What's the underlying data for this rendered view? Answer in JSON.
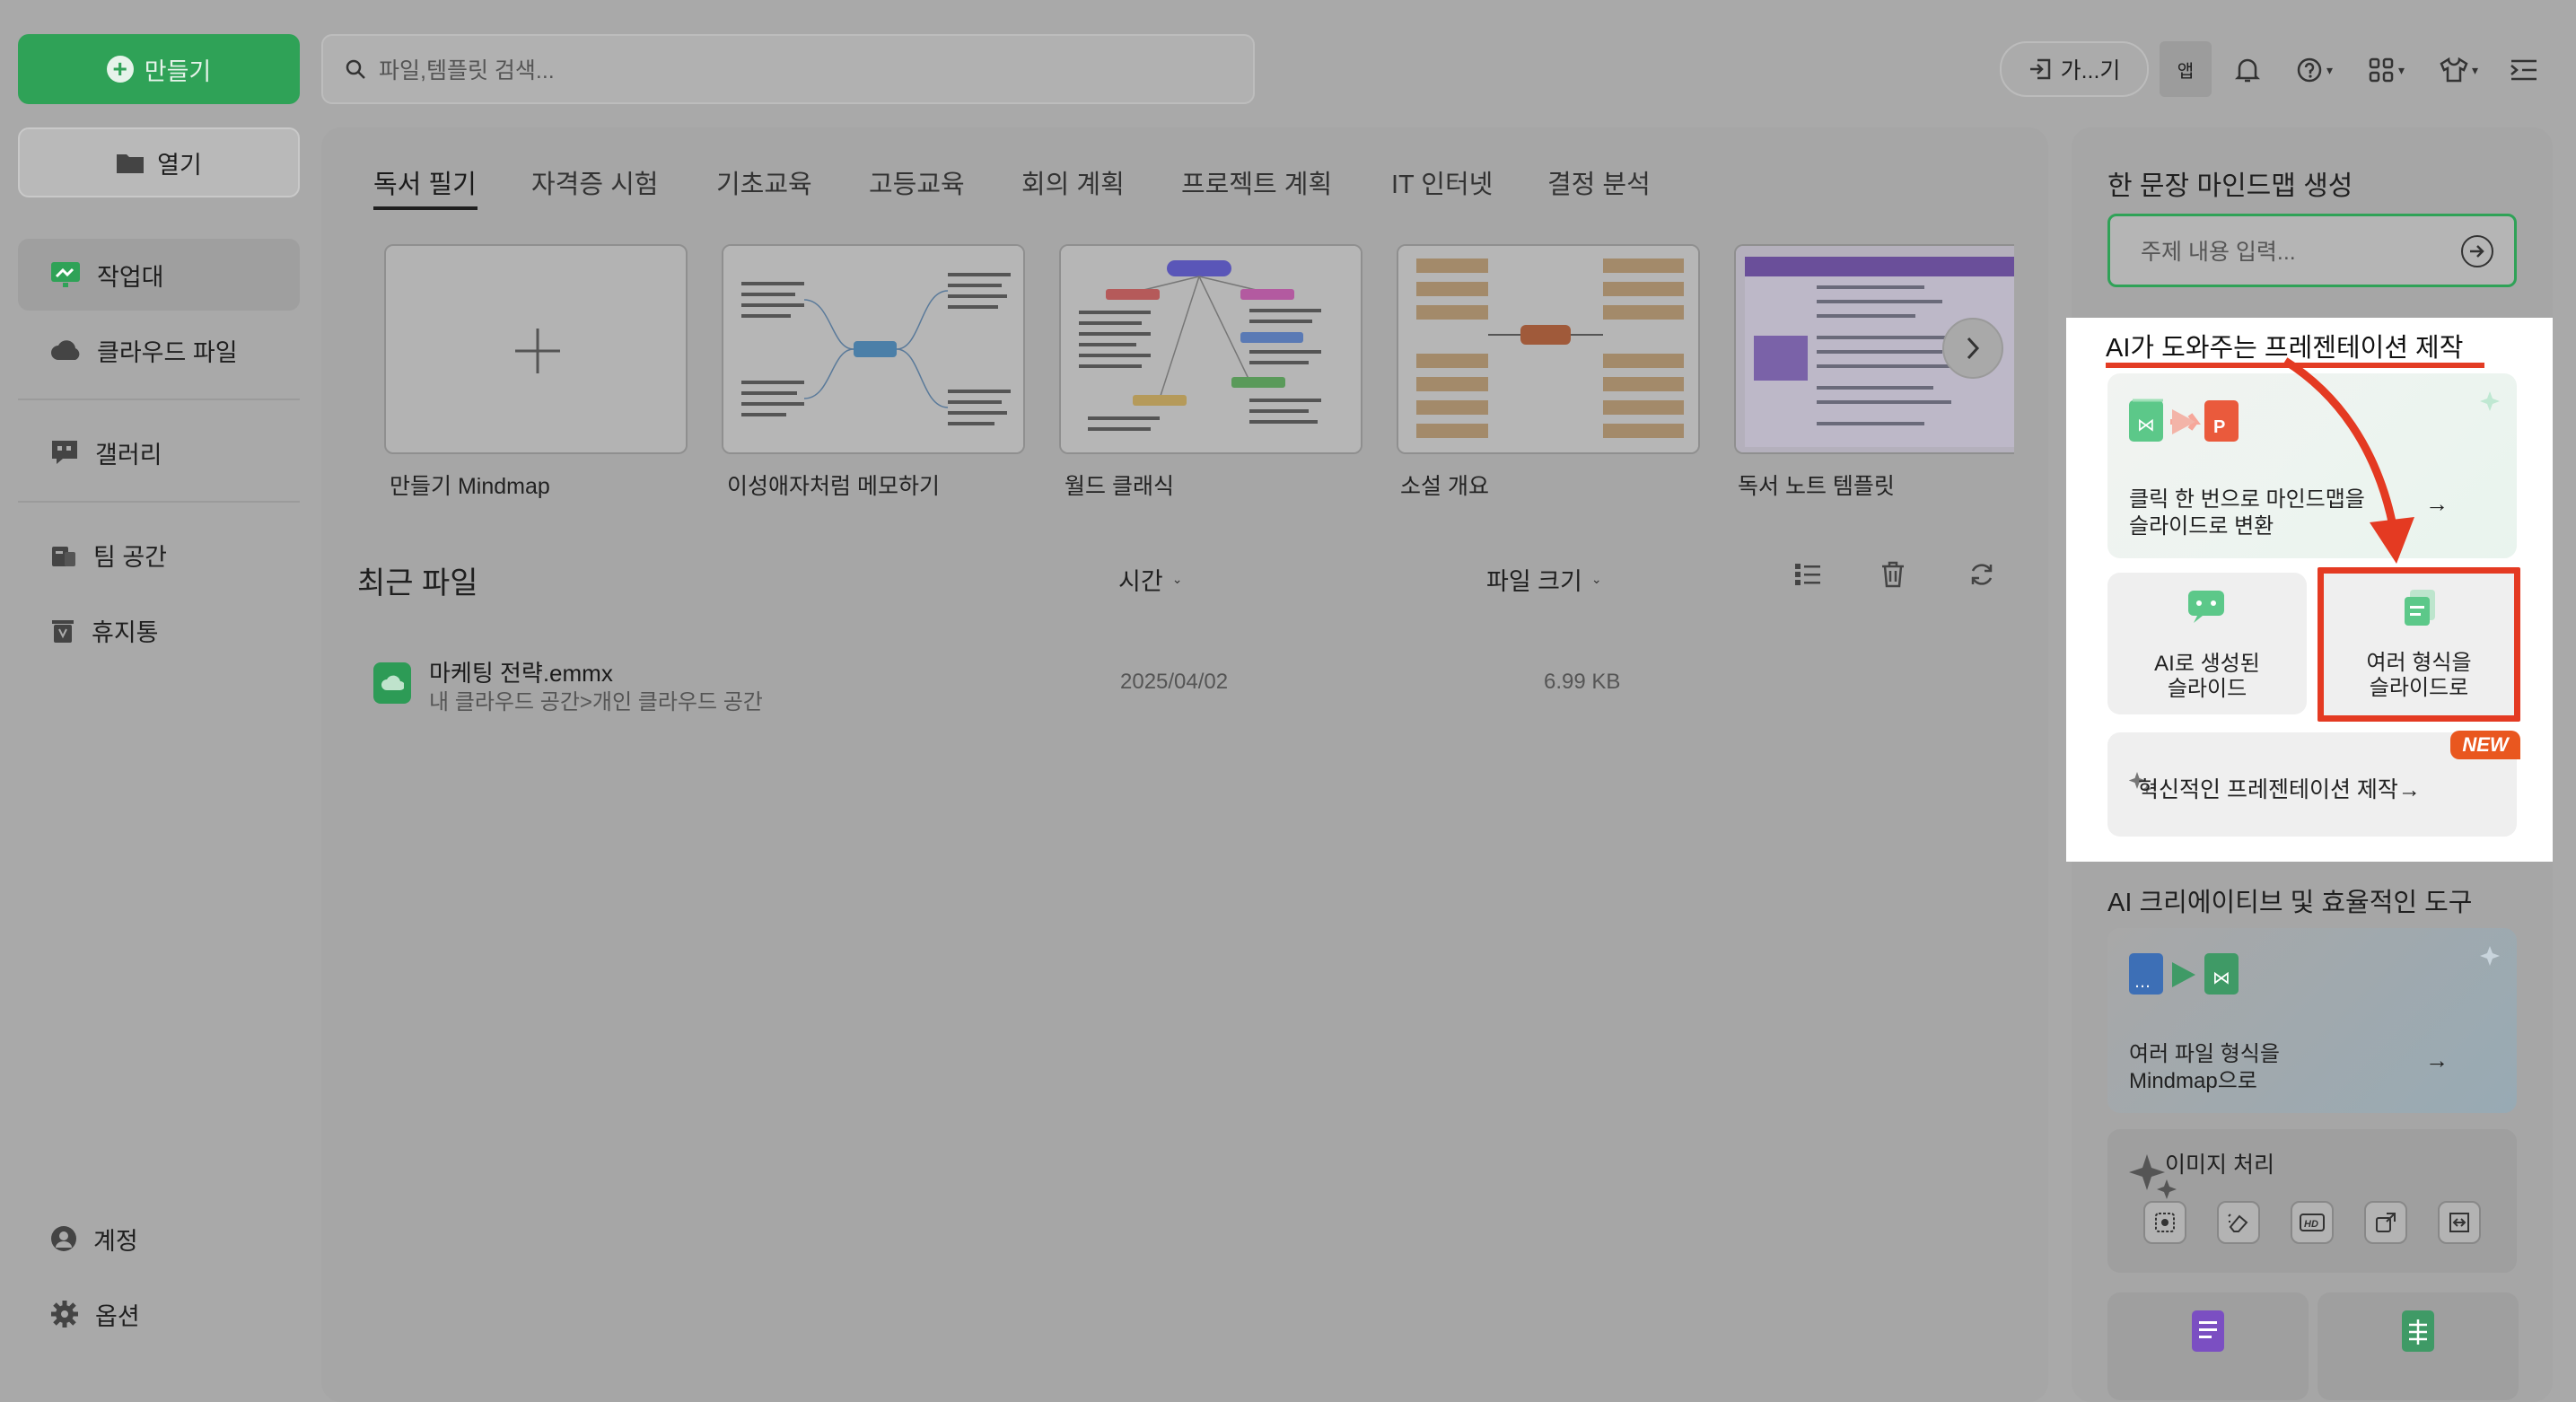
{
  "sidebar": {
    "create_label": "만들기",
    "open_label": "열기",
    "items": [
      {
        "label": "작업대"
      },
      {
        "label": "클라우드 파일"
      },
      {
        "label": "갤러리"
      },
      {
        "label": "팀 공간"
      },
      {
        "label": "휴지통"
      }
    ],
    "account_label": "계정",
    "options_label": "옵션"
  },
  "topbar": {
    "search_placeholder": "파일,템플릿 검색...",
    "goto_label": "가...기",
    "app_label": "앱"
  },
  "tabs": [
    "독서 필기",
    "자격증 시험",
    "기초교육",
    "고등교육",
    "회의 계획",
    "프로젝트 계획",
    "IT 인터넷",
    "결정 분석"
  ],
  "templates": [
    {
      "label": "만들기 Mindmap"
    },
    {
      "label": "이성애자처럼 메모하기"
    },
    {
      "label": "월드 클래식"
    },
    {
      "label": "소설 개요"
    },
    {
      "label": "독서 노트 템플릿"
    }
  ],
  "recent": {
    "title": "최근 파일",
    "col_time": "시간",
    "col_size": "파일 크기",
    "files": [
      {
        "name": "마케팅 전략.emmx",
        "path": "내 클라우드 공간>개인 클라우드 공간",
        "date": "2025/04/02",
        "size": "6.99 KB"
      }
    ]
  },
  "right": {
    "mindmap_gen_title": "한 문장 마인드맵 생성",
    "topic_placeholder": "주제 내용 입력...",
    "ai_present_title": "AI가 도와주는 프레젠테이션 제작",
    "convert_line1": "클릭 한 번으로 마인드맵을",
    "convert_line2": "슬라이드로 변환",
    "ai_slide_line1": "AI로 생성된",
    "ai_slide_line2": "슬라이드",
    "multi_slide_line1": "여러 형식을",
    "multi_slide_line2": "슬라이드로",
    "innovate_label": "혁신적인 프레젠테이션 제작",
    "new_badge": "NEW",
    "ai_tools_title": "AI 크리에이티브 및 효율적인 도구",
    "multi_file_line1": "여러 파일 형식을",
    "multi_file_line2": "Mindmap으로",
    "image_proc_title": "이미지 처리"
  },
  "colors": {
    "accent": "#2fa257",
    "highlight": "#e43a22",
    "badge": "#e9571f"
  }
}
